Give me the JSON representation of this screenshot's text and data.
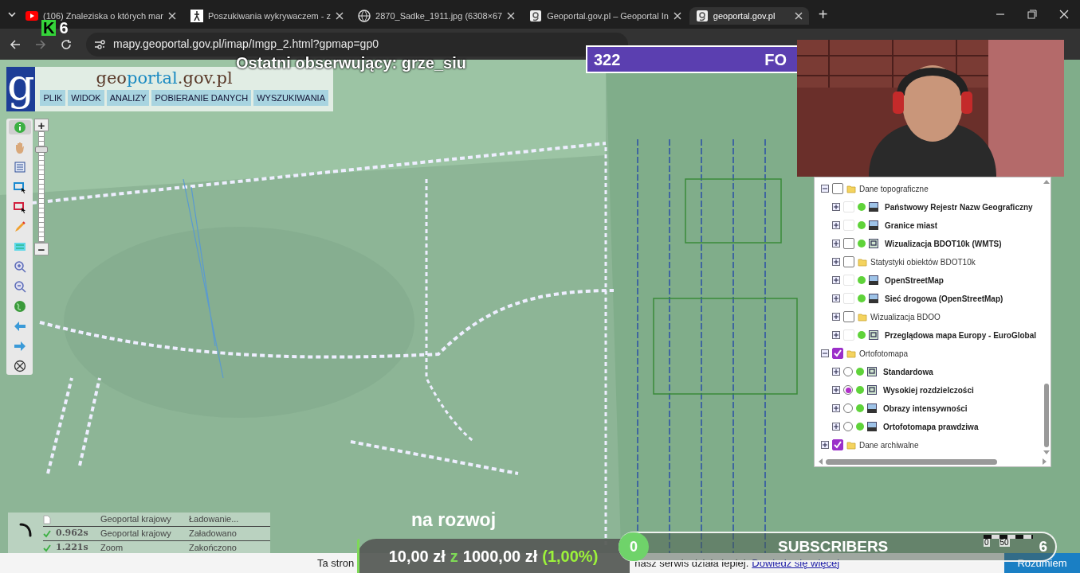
{
  "browser": {
    "tabs": [
      {
        "title": "(106) Znaleziska o których mar",
        "selected": false
      },
      {
        "title": "Poszukiwania wykrywaczem - z",
        "selected": false
      },
      {
        "title": "2870_Sadke_1911.jpg (6308×67",
        "selected": false
      },
      {
        "title": "Geoportal.gov.pl – Geoportal In",
        "selected": false
      },
      {
        "title": "geoportal.gov.pl",
        "selected": true
      }
    ],
    "new_tab": "+",
    "address": "mapy.geoportal.gov.pl/imap/Imgp_2.html?gpmap=gp0"
  },
  "stream": {
    "badge_letter": "K",
    "badge_count": "6",
    "last_follower": "Ostatni obserwujący: grze_siu",
    "counter": "322",
    "counter_right": "FO",
    "caption": "na rozwoj",
    "donation": {
      "raised": "10,00 zł",
      "of_word": "z",
      "goal": "1000,00 zł",
      "percent": "(1,00%)",
      "level": 0.01
    },
    "subscribers": {
      "current": "0",
      "label": "SUBSCRIBERS",
      "goal": "6"
    }
  },
  "geoportal": {
    "logo_glyph": "g",
    "title_parts": [
      "geo",
      "portal",
      ".gov.pl"
    ],
    "menu": [
      "PLIK",
      "WIDOK",
      "ANALIZY",
      "POBIERANIE DANYCH",
      "WYSZUKIWANIA"
    ],
    "zoom": {
      "plus": "+",
      "minus": "−",
      "level": 0.86
    },
    "tools": [
      {
        "kind": "info",
        "selected": true
      },
      {
        "kind": "pan",
        "selected": false
      },
      {
        "kind": "table",
        "selected": false
      },
      {
        "kind": "select-blue",
        "selected": false
      },
      {
        "kind": "select-red",
        "selected": false
      },
      {
        "kind": "pencil",
        "selected": false
      },
      {
        "kind": "xyz",
        "selected": false
      },
      {
        "kind": "zoom-in",
        "selected": false
      },
      {
        "kind": "zoom-out",
        "selected": false
      },
      {
        "kind": "globe",
        "selected": false
      },
      {
        "kind": "back",
        "selected": false
      },
      {
        "kind": "forward",
        "selected": false
      },
      {
        "kind": "compass",
        "selected": false
      }
    ],
    "layers": [
      {
        "kind": "folder",
        "label": "Dane topograficzne",
        "checked": false,
        "expanded": true,
        "children": [
          {
            "kind": "wms",
            "label": "Państwowy Rejestr Nazw Geograficzny",
            "disabled": true
          },
          {
            "kind": "wms",
            "label": "Granice miast",
            "disabled": true
          },
          {
            "kind": "wmts",
            "label": "Wizualizacja BDOT10k (WMTS)",
            "disabled": false
          },
          {
            "kind": "folder",
            "label": "Statystyki obiektów BDOT10k",
            "checked": false,
            "expanded": false
          },
          {
            "kind": "wms",
            "label": "OpenStreetMap",
            "disabled": true
          },
          {
            "kind": "wms",
            "label": "Sieć drogowa (OpenStreetMap)",
            "disabled": true
          },
          {
            "kind": "folder",
            "label": "Wizualizacja BDOO",
            "checked": false,
            "expanded": false
          },
          {
            "kind": "wmts",
            "label": "Przeglądowa mapa Europy - EuroGlobal",
            "disabled": true
          }
        ]
      },
      {
        "kind": "folder",
        "label": "Ortofotomapa",
        "checked": true,
        "expanded": true,
        "children": [
          {
            "kind": "wmts",
            "label": "Standardowa",
            "selected": false
          },
          {
            "kind": "wmts",
            "label": "Wysokiej rozdzielczości",
            "selected": true
          },
          {
            "kind": "wms",
            "label": "Obrazy intensywności",
            "selected": false
          },
          {
            "kind": "wms",
            "label": "Ortofotomapa prawdziwa",
            "selected": false
          }
        ]
      },
      {
        "kind": "folder",
        "label": "Dane archiwalne",
        "checked": true,
        "expanded": false
      }
    ],
    "log": [
      {
        "kind": "loading",
        "source": "Geoportal krajowy",
        "message": "Ładowanie..."
      },
      {
        "kind": "done",
        "time": "0.962s",
        "source": "Geoportal krajowy",
        "message": "Załadowano"
      },
      {
        "kind": "done",
        "time": "1.221s",
        "source": "Zoom",
        "message": "Zakończono"
      }
    ],
    "scale": {
      "labels": [
        "0",
        "50"
      ]
    }
  },
  "cookie_bar": {
    "text_start": "Ta stron",
    "text_end": "nasz serwis działa lepiej.",
    "link": "Dowiedz się więcej",
    "button": "Rozumiem"
  }
}
